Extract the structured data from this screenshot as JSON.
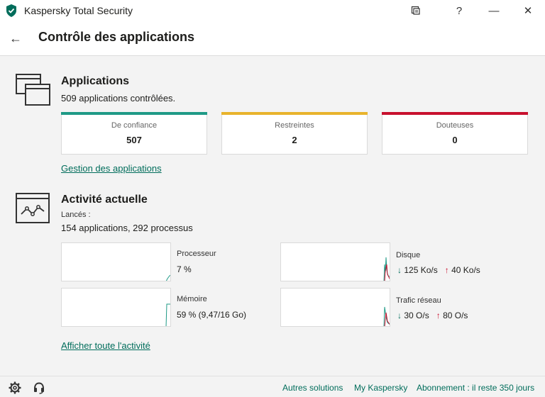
{
  "window": {
    "title": "Kaspersky Total Security",
    "help_label": "?",
    "minimize_label": "—",
    "close_label": "✕"
  },
  "header": {
    "back_label": "←",
    "title": "Contrôle des applications"
  },
  "applications": {
    "title": "Applications",
    "subtitle": "509 applications contrôlées.",
    "cards": [
      {
        "label": "De confiance",
        "value": "507",
        "color": "#1f9a86"
      },
      {
        "label": "Restreintes",
        "value": "2",
        "color": "#e8b32c"
      },
      {
        "label": "Douteuses",
        "value": "0",
        "color": "#c8102e"
      }
    ],
    "manage_link": "Gestion des applications"
  },
  "activity": {
    "title": "Activité actuelle",
    "launched_label": "Lancés :",
    "launched_value": "154 applications, 292 processus",
    "metrics": {
      "cpu": {
        "label": "Processeur",
        "value": "7 %"
      },
      "memory": {
        "label": "Mémoire",
        "value": "59 % (9,47/16 Go)"
      },
      "disk": {
        "label": "Disque",
        "down": "125 Ko/s",
        "up": "40 Ko/s"
      },
      "network": {
        "label": "Trafic réseau",
        "down": "30 O/s",
        "up": "80 O/s"
      }
    },
    "all_activity_link": "Afficher toute l'activité"
  },
  "footer": {
    "other_solutions": "Autres solutions",
    "my_kaspersky": "My Kaspersky",
    "subscription": "Abonnement : il reste 350 jours"
  },
  "colors": {
    "accent_green": "#006d5b",
    "trusted": "#1f9a86",
    "restricted": "#e8b32c",
    "suspicious": "#c8102e"
  }
}
